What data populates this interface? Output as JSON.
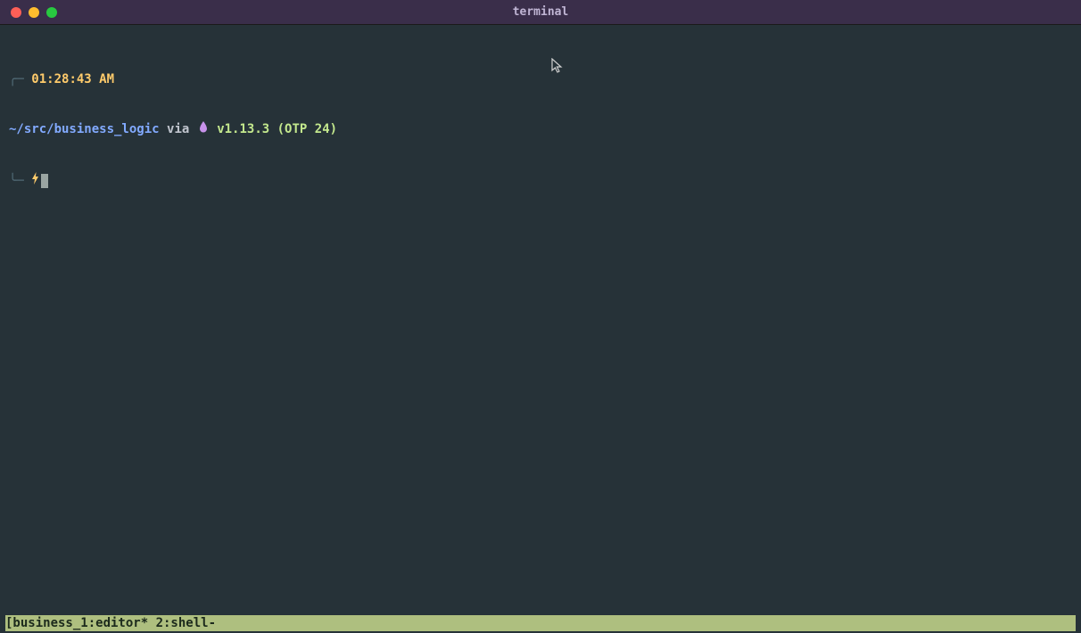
{
  "window": {
    "title": "terminal"
  },
  "prompt": {
    "time": "01:28:43 AM",
    "path": "~/src/business_logic",
    "via": "via",
    "drop_glyph": "💧",
    "version": "v1.13.3 (OTP 24)",
    "lightning": "⚡"
  },
  "statusbar": {
    "text": "[business_1:editor* 2:shell-"
  }
}
